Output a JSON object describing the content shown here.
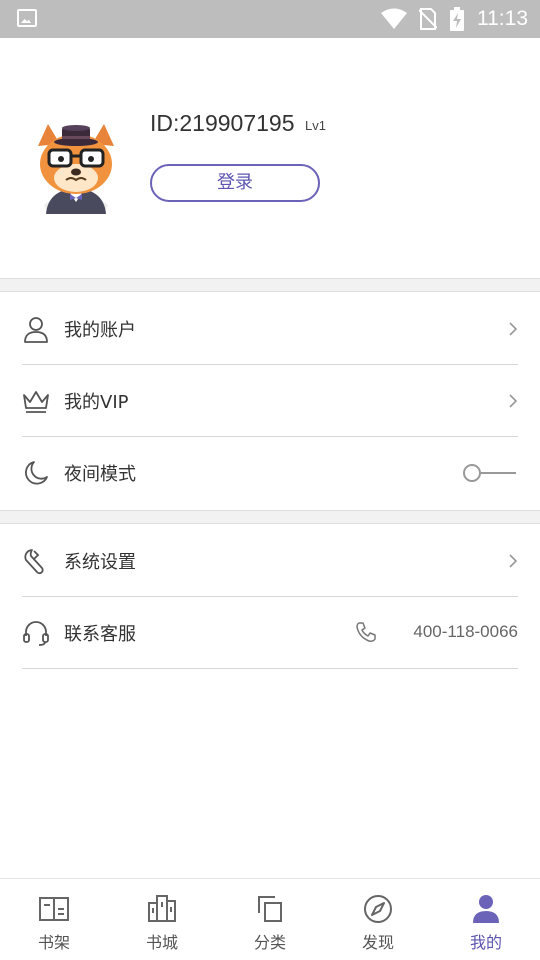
{
  "status_bar": {
    "time": "11:13",
    "icons": [
      "gallery-icon",
      "wifi-icon",
      "no-sim-icon",
      "battery-charging-icon"
    ]
  },
  "profile": {
    "user_id": "ID:219907195",
    "level": "Lv1",
    "login_label": "登录",
    "avatar_icon": "fox-gentleman-avatar"
  },
  "menu_group_1": [
    {
      "label": "我的账户",
      "icon": "user-icon",
      "accessory": "chevron"
    },
    {
      "label": "我的VIP",
      "icon": "crown-icon",
      "accessory": "chevron"
    },
    {
      "label": "夜间模式",
      "icon": "moon-icon",
      "accessory": "toggle",
      "toggle_on": false
    }
  ],
  "menu_group_2": [
    {
      "label": "系统设置",
      "icon": "wrench-icon",
      "accessory": "chevron"
    },
    {
      "label": "联系客服",
      "icon": "headset-icon",
      "accessory": "phone",
      "phone": "400-118-0066"
    }
  ],
  "tabbar": {
    "tabs": [
      {
        "label": "书架",
        "icon": "bookshelf-icon",
        "active": false
      },
      {
        "label": "书城",
        "icon": "bookstore-icon",
        "active": false
      },
      {
        "label": "分类",
        "icon": "category-icon",
        "active": false
      },
      {
        "label": "发现",
        "icon": "compass-icon",
        "active": false
      },
      {
        "label": "我的",
        "icon": "profile-icon",
        "active": true
      }
    ]
  },
  "colors": {
    "accent": "#5c55b0",
    "status_bar": "#bdbdbd",
    "separator": "#f2f2f2",
    "text": "#333333"
  }
}
